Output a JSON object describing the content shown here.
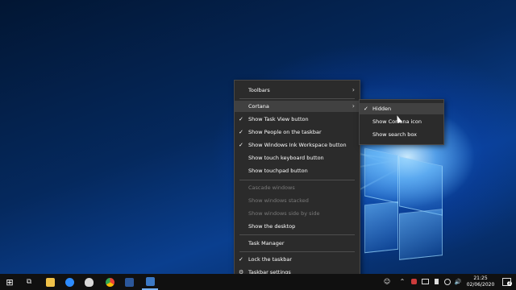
{
  "context_menu": {
    "items": [
      {
        "label": "Toolbars",
        "check": "",
        "submenu": true,
        "disabled": false
      },
      {
        "label": "Cortana",
        "check": "",
        "submenu": true,
        "disabled": false
      },
      {
        "label": "Show Task View button",
        "check": "✓",
        "submenu": false,
        "disabled": false
      },
      {
        "label": "Show People on the taskbar",
        "check": "✓",
        "submenu": false,
        "disabled": false
      },
      {
        "label": "Show Windows Ink Workspace button",
        "check": "✓",
        "submenu": false,
        "disabled": false
      },
      {
        "label": "Show touch keyboard button",
        "check": "",
        "submenu": false,
        "disabled": false
      },
      {
        "label": "Show touchpad button",
        "check": "",
        "submenu": false,
        "disabled": false
      },
      {
        "label": "Cascade windows",
        "check": "",
        "submenu": false,
        "disabled": true
      },
      {
        "label": "Show windows stacked",
        "check": "",
        "submenu": false,
        "disabled": true
      },
      {
        "label": "Show windows side by side",
        "check": "",
        "submenu": false,
        "disabled": true
      },
      {
        "label": "Show the desktop",
        "check": "",
        "submenu": false,
        "disabled": false
      },
      {
        "label": "Task Manager",
        "check": "",
        "submenu": false,
        "disabled": false
      },
      {
        "label": "Lock the taskbar",
        "check": "✓",
        "submenu": false,
        "disabled": false
      },
      {
        "label": "Taskbar settings",
        "check": "",
        "submenu": false,
        "disabled": false
      }
    ],
    "arrow_glyph": "›",
    "gear_glyph": "⚙"
  },
  "cortana_submenu": {
    "items": [
      {
        "label": "Hidden",
        "check": "✓"
      },
      {
        "label": "Show Cortana icon",
        "check": ""
      },
      {
        "label": "Show search box",
        "check": ""
      }
    ]
  },
  "taskbar": {
    "start_glyph": "⊞",
    "task_view_glyph": "⧉",
    "apps": [
      {
        "name": "file-explorer",
        "color": "#f0c24a"
      },
      {
        "name": "zoom",
        "color": "#2d8cff"
      },
      {
        "name": "paint",
        "color": "#d9d9d9"
      },
      {
        "name": "chrome",
        "color": "#ea4335"
      },
      {
        "name": "word",
        "color": "#2b579a"
      },
      {
        "name": "app-s",
        "color": "#3b78c4"
      }
    ],
    "tray": {
      "people_glyph": "☺",
      "chevron_glyph": "⌃",
      "speaker_glyph": "🔊",
      "notification_count": "2"
    },
    "time": "21:25",
    "date": "02/06/2020"
  },
  "colors": {
    "menu_bg": "#2b2b2b",
    "highlight": "#414141",
    "disabled": "#7a7a7a"
  }
}
